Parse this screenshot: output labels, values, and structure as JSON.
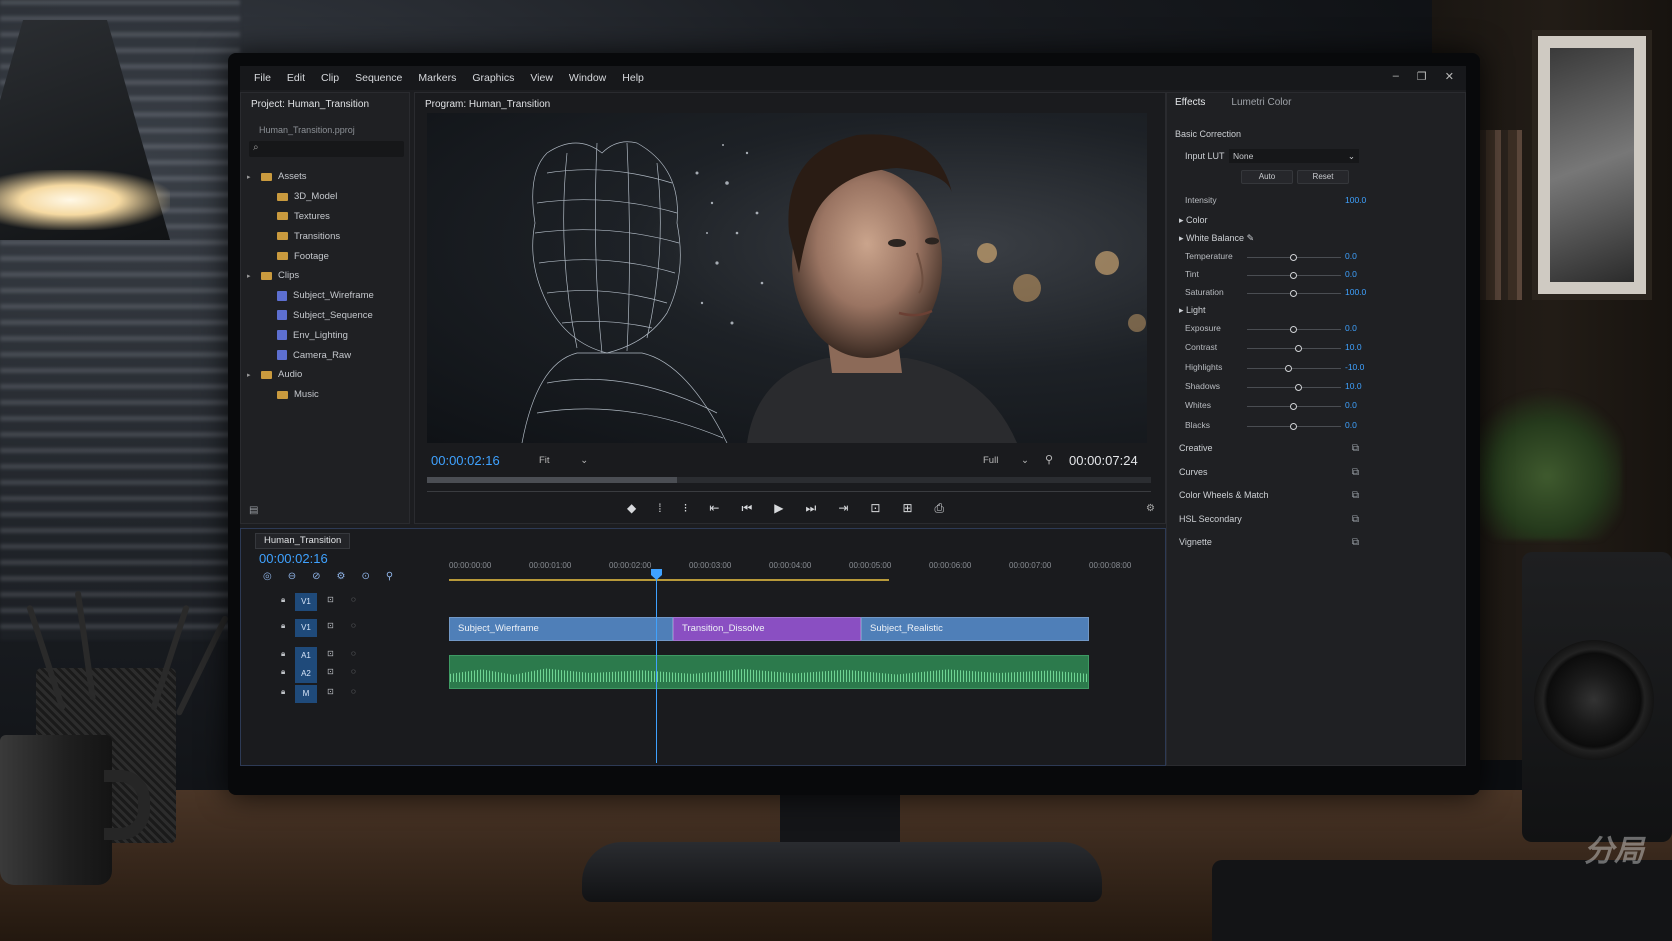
{
  "menu": [
    "File",
    "Edit",
    "Clip",
    "Sequence",
    "Markers",
    "Graphics",
    "View",
    "Window",
    "Help"
  ],
  "project": {
    "tab_label": "Project: Human_Transition",
    "file_name": "Human_Transition.pproj",
    "tree": [
      {
        "label": "Assets",
        "kind": "folder",
        "level": 0
      },
      {
        "label": "3D_Model",
        "kind": "folder",
        "level": 1
      },
      {
        "label": "Textures",
        "kind": "folder",
        "level": 1
      },
      {
        "label": "Transitions",
        "kind": "folder",
        "level": 1
      },
      {
        "label": "Footage",
        "kind": "folder",
        "level": 1
      },
      {
        "label": "Clips",
        "kind": "folder",
        "level": 0
      },
      {
        "label": "Subject_Wireframe",
        "kind": "clip",
        "level": 1
      },
      {
        "label": "Subject_Sequence",
        "kind": "clip",
        "level": 1
      },
      {
        "label": "Env_Lighting",
        "kind": "clip",
        "level": 1
      },
      {
        "label": "Camera_Raw",
        "kind": "clip",
        "level": 1
      },
      {
        "label": "Audio",
        "kind": "folder",
        "level": 0
      },
      {
        "label": "Music",
        "kind": "folder",
        "level": 1
      }
    ]
  },
  "program": {
    "tab_label": "Program: Human_Transition",
    "timecode_current": "00:00:02:16",
    "timecode_duration": "00:00:07:24",
    "fit_label": "Fit",
    "quality_label": "Full"
  },
  "effects": {
    "tab_effects": "Effects",
    "tab_lumetri": "Lumetri Color",
    "basic_correction": "Basic Correction",
    "input_lut_label": "Input LUT",
    "input_lut_value": "None",
    "auto_label": "Auto",
    "reset_label": "Reset",
    "intensity": {
      "label": "Intensity",
      "value": "100.0"
    },
    "color_label": "Color",
    "white_balance_label": "White Balance",
    "light_label": "Light",
    "rows": [
      {
        "label": "Temperature",
        "value": "0.0",
        "pos": 0.5
      },
      {
        "label": "Tint",
        "value": "0.0",
        "pos": 0.5
      },
      {
        "label": "Saturation",
        "value": "100.0",
        "pos": 0.5
      },
      {
        "label": "Exposure",
        "value": "0.0",
        "pos": 0.5
      },
      {
        "label": "Contrast",
        "value": "10.0",
        "pos": 0.55
      },
      {
        "label": "Highlights",
        "value": "-10.0",
        "pos": 0.45
      },
      {
        "label": "Shadows",
        "value": "10.0",
        "pos": 0.55
      },
      {
        "label": "Whites",
        "value": "0.0",
        "pos": 0.5
      },
      {
        "label": "Blacks",
        "value": "0.0",
        "pos": 0.5
      }
    ],
    "sections": [
      "Creative",
      "Curves",
      "Color Wheels & Match",
      "HSL Secondary",
      "Vignette"
    ]
  },
  "timeline": {
    "sequence_tab": "Human_Transition",
    "timecode": "00:00:02:16",
    "ruler_ticks": [
      "00:00:00:00",
      "00:00:01:00",
      "00:00:02:00",
      "00:00:03:00",
      "00:00:04:00",
      "00:00:05:00",
      "00:00:06:00",
      "00:00:07:00",
      "00:00:08:00"
    ],
    "tracks": [
      "V1",
      "V1",
      "A1",
      "A2",
      "M"
    ],
    "clips": [
      {
        "label": "Subject_Wierframe",
        "color": "#4f7fb8"
      },
      {
        "label": "Transition_Dissolve",
        "color": "#8a4fc2"
      },
      {
        "label": "Subject_Realistic",
        "color": "#4f7fb8"
      }
    ]
  }
}
